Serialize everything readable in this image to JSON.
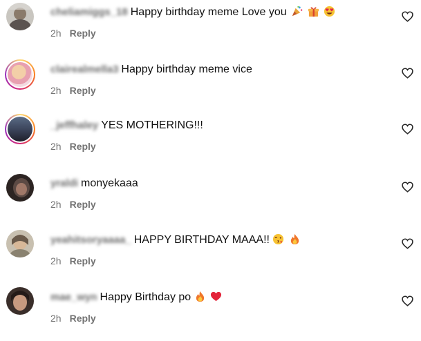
{
  "comments": [
    {
      "username": "cheliamiggs_18",
      "text": "Happy birthday meme Love you",
      "emojis": [
        "party-popper-icon",
        "gift-icon",
        "heart-eyes-icon"
      ],
      "time": "2h",
      "reply": "Reply"
    },
    {
      "username": "clairealmella3",
      "text": "Happy birthday meme vice",
      "emojis": [],
      "time": "2h",
      "reply": "Reply"
    },
    {
      "username": "_jeffhaley",
      "text": "YES MOTHERING!!!",
      "emojis": [],
      "time": "2h",
      "reply": "Reply"
    },
    {
      "username": "yraldi",
      "text": "monyekaaa",
      "emojis": [],
      "time": "2h",
      "reply": "Reply"
    },
    {
      "username": "yeahitsoryaaaa_",
      "text": "HAPPY BIRTHDAY MAAA!!",
      "emojis": [
        "kiss-face-icon",
        "fire-icon"
      ],
      "time": "2h",
      "reply": "Reply"
    },
    {
      "username": "mae_wyn",
      "text": "Happy Birthday po",
      "emojis": [
        "fire-icon",
        "red-heart-icon"
      ],
      "time": "2h",
      "reply": "Reply"
    }
  ],
  "colors": {
    "meta_gray": "#737373",
    "username_gray": "#6b6b6b",
    "story_ring_gradient": [
      "#feda75",
      "#fa7e1e",
      "#d62976",
      "#962fbf"
    ]
  }
}
